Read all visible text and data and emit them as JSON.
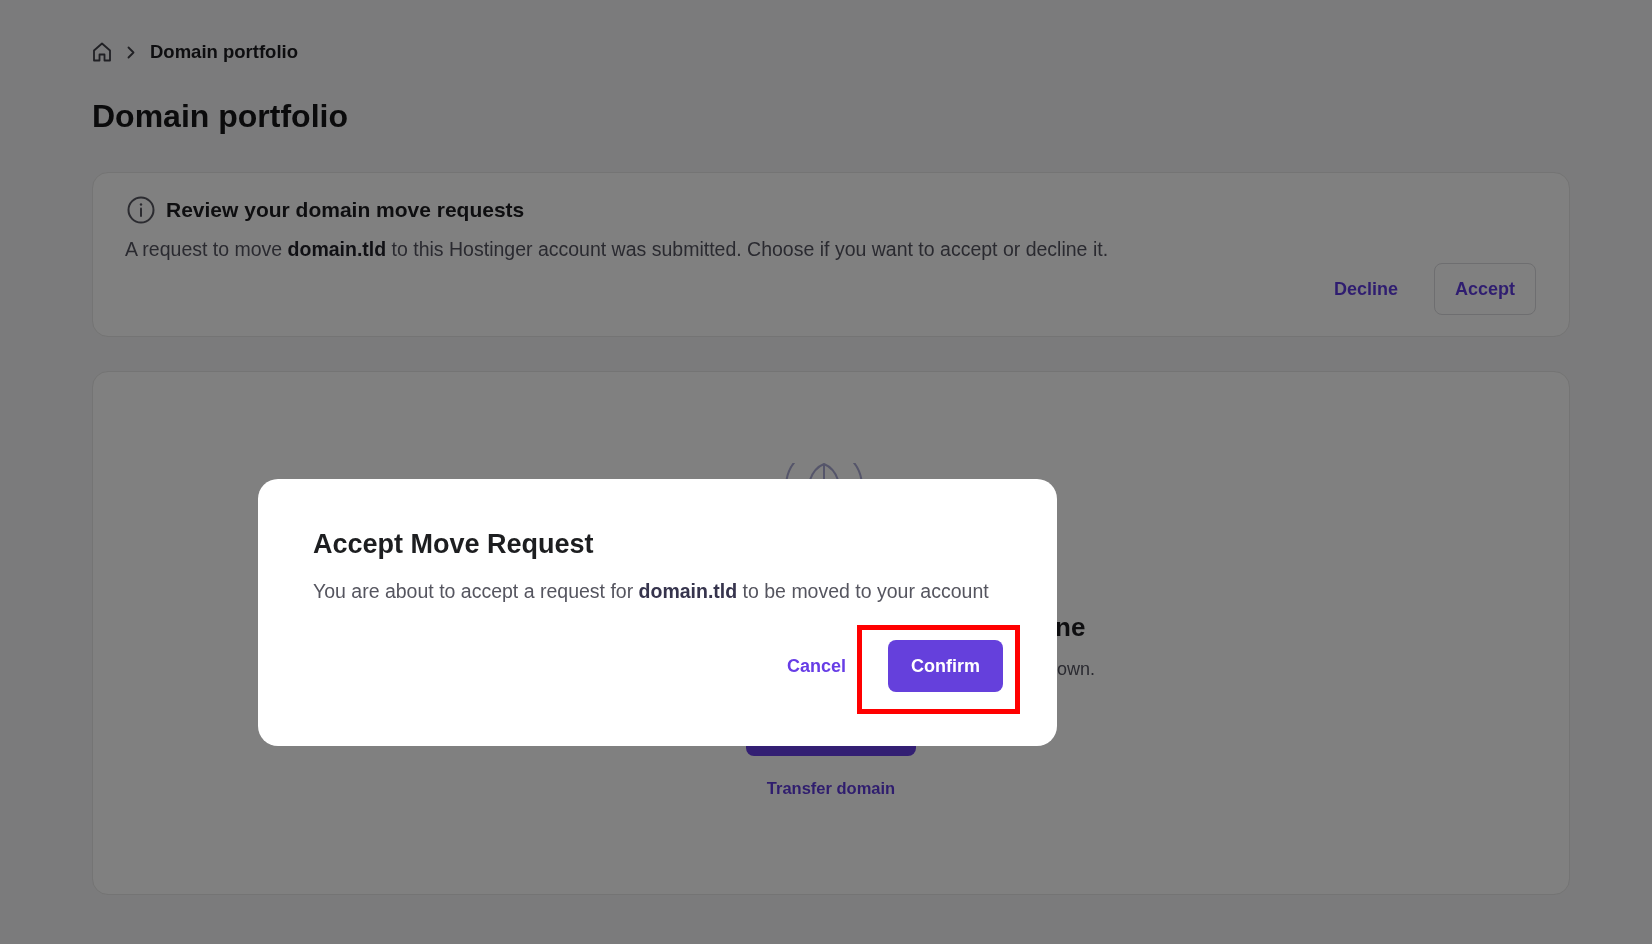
{
  "breadcrumb": {
    "current": "Domain portfolio"
  },
  "page_title": "Domain portfolio",
  "notice": {
    "title": "Review your domain move requests",
    "text": "A request to move **domain.tld** to this Hostinger account was submitted. Choose if you want to accept or decline it.",
    "buttons": [
      {
        "label": "Decline",
        "kind": "text"
      },
      {
        "label": "Accept",
        "kind": "outline"
      }
    ]
  },
  "empty_state": {
    "heading": "ne",
    "text": "own.",
    "link": "Transfer domain"
  },
  "dialog": {
    "title": "Accept Move Request",
    "text": "You are about to accept a request for **domain.tld** to be moved to your account",
    "buttons": [
      {
        "label": "Cancel",
        "kind": "text",
        "highlighted": false
      },
      {
        "label": "Confirm",
        "kind": "primary",
        "highlighted": true
      }
    ]
  }
}
